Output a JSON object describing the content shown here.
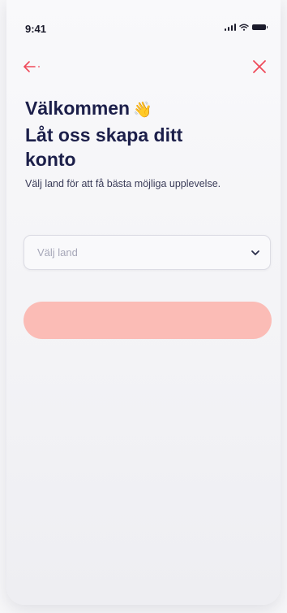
{
  "status_bar": {
    "time": "9:41"
  },
  "nav": {
    "back_icon": "arrow-left-icon",
    "close_icon": "close-icon",
    "accent_color": "#ef4a5a"
  },
  "header": {
    "title_line1": "Välkommen",
    "title_emoji": "👋",
    "title_line2": "Låt oss skapa ditt",
    "title_line3": "konto",
    "subtitle": "Välj land för att få bästa möjliga upplevelse."
  },
  "country_select": {
    "placeholder": "Välj land",
    "icon": "chevron-down-icon"
  },
  "continue_button": {
    "label": "",
    "color": "#fbbcb6"
  }
}
